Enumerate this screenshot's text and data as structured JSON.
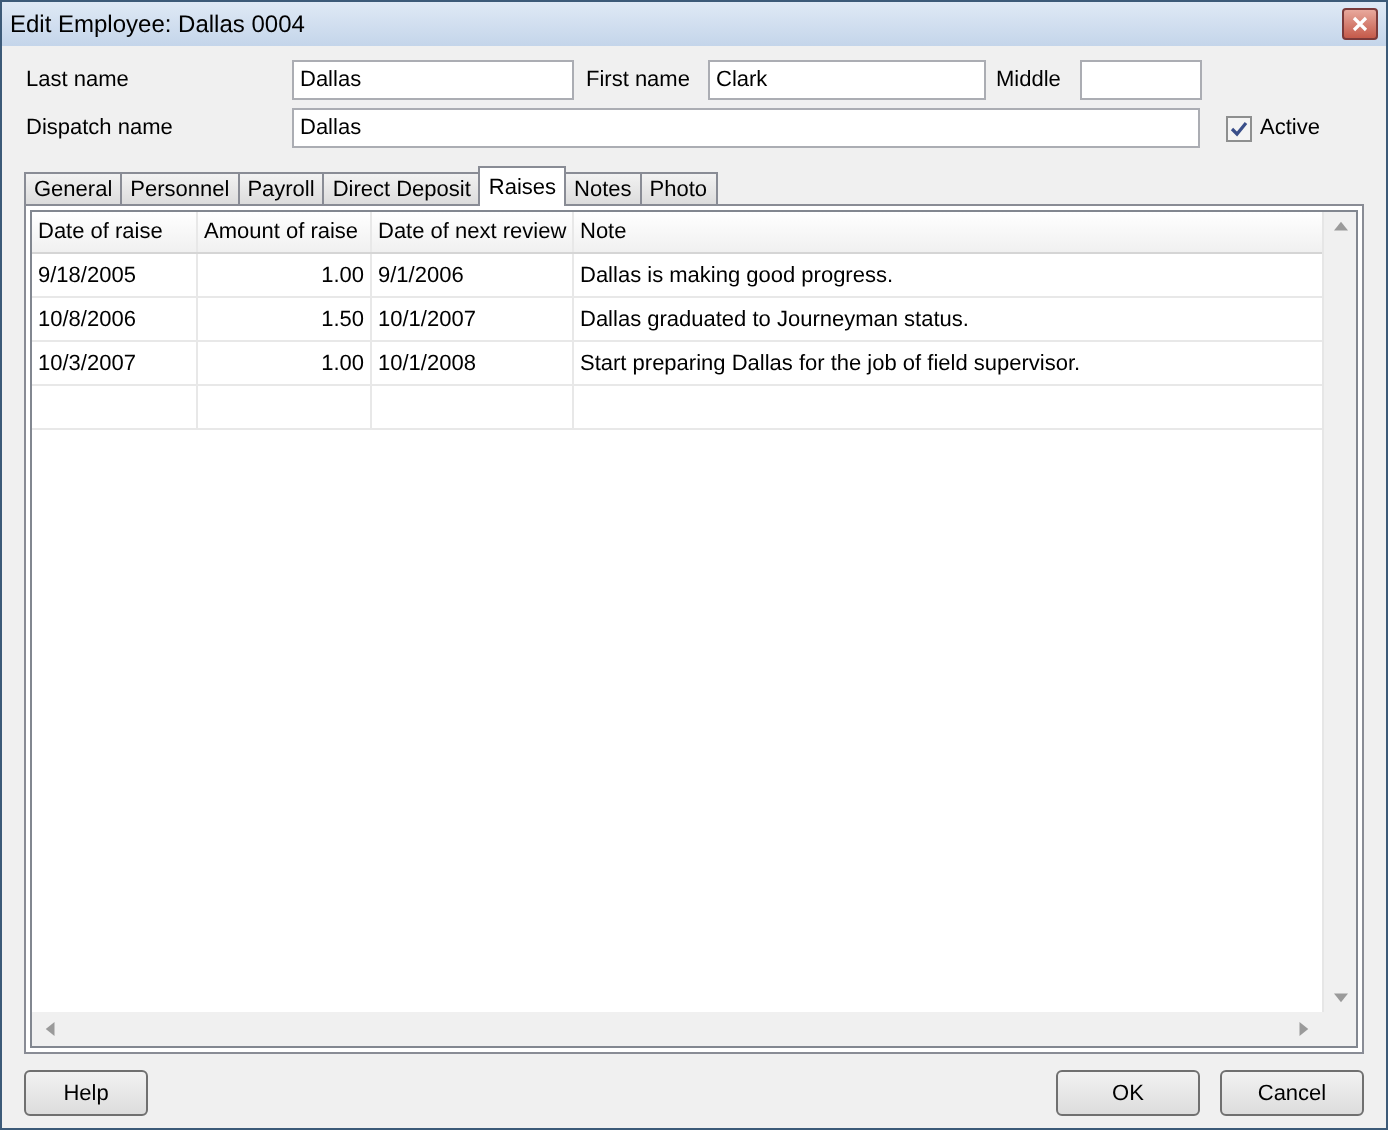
{
  "window": {
    "title": "Edit Employee: Dallas 0004"
  },
  "fields": {
    "last_name": {
      "label": "Last name",
      "value": "Dallas"
    },
    "first_name": {
      "label": "First name",
      "value": "Clark"
    },
    "middle": {
      "label": "Middle"
    },
    "dispatch_name": {
      "label": "Dispatch name",
      "value": "Dallas"
    },
    "active": {
      "label": "Active",
      "checked": true
    }
  },
  "tabs": [
    {
      "label": "General",
      "selected": false
    },
    {
      "label": "Personnel",
      "selected": false
    },
    {
      "label": "Payroll",
      "selected": false
    },
    {
      "label": "Direct Deposit",
      "selected": false
    },
    {
      "label": "Raises",
      "selected": true
    },
    {
      "label": "Notes",
      "selected": false
    },
    {
      "label": "Photo",
      "selected": false
    }
  ],
  "table": {
    "columns": [
      "Date of raise",
      "Amount of raise",
      "Date of next review",
      "Note"
    ],
    "rows": [
      [
        "9/18/2005",
        "1.00",
        "9/1/2006",
        "Dallas is making good progress."
      ],
      [
        "10/8/2006",
        "1.50",
        "10/1/2007",
        "Dallas graduated to Journeyman status."
      ],
      [
        "10/3/2007",
        "1.00",
        "10/1/2008",
        "Start preparing Dallas for the job of field supervisor."
      ]
    ]
  },
  "buttons": {
    "help": "Help",
    "ok": "OK",
    "cancel": "Cancel"
  }
}
